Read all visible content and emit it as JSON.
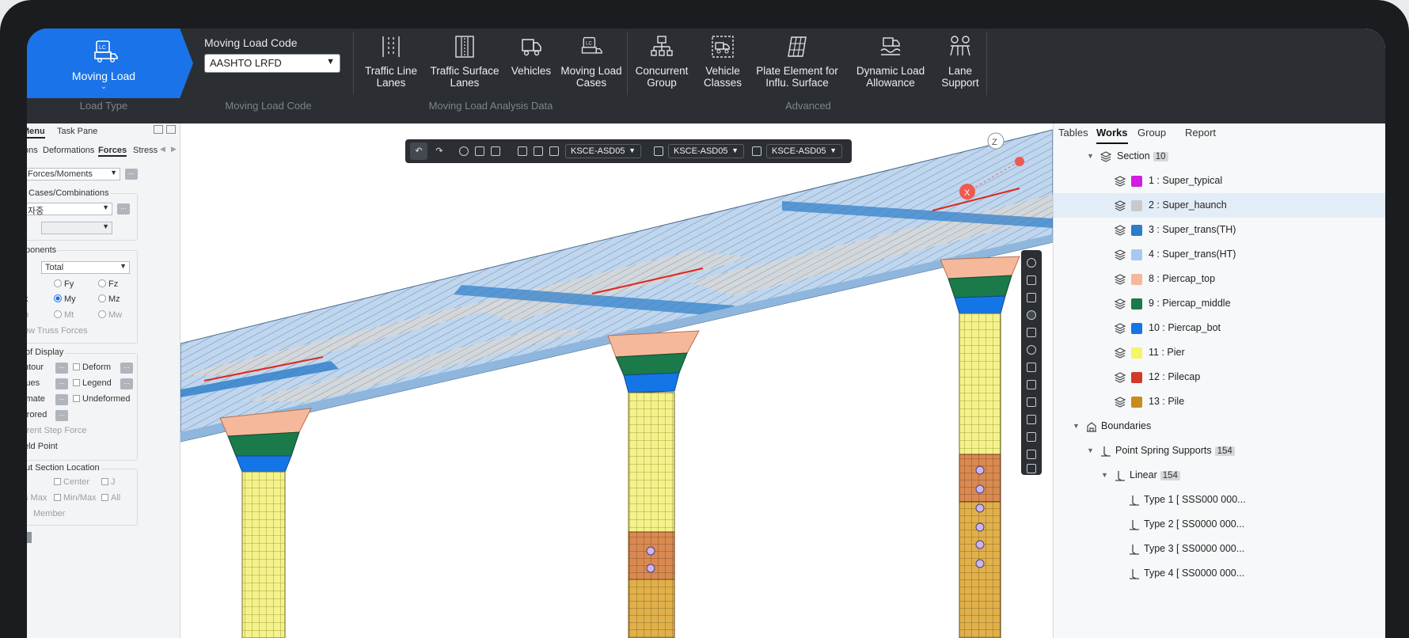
{
  "ribbon": {
    "active_tab": {
      "label": "Moving Load",
      "icon": "lc-truck-icon"
    },
    "moving_load_code": {
      "label": "Moving Load Code",
      "value": "AASHTO LRFD"
    },
    "buttons": [
      {
        "label": "Traffic Line Lanes",
        "icon": "traffic-line-icon"
      },
      {
        "label": "Traffic Surface Lanes",
        "icon": "traffic-surface-icon"
      },
      {
        "label": "Vehicles",
        "icon": "vehicle-icon"
      },
      {
        "label": "Moving Load Cases",
        "icon": "lc-truck-icon"
      },
      {
        "label": "Concurrent Group",
        "icon": "concurrent-group-icon"
      },
      {
        "label": "Vehicle Classes",
        "icon": "vehicle-classes-icon"
      },
      {
        "label": "Plate Element for Influ. Surface",
        "icon": "plate-element-icon"
      },
      {
        "label": "Dynamic Load Allowance",
        "icon": "dynamic-load-icon"
      },
      {
        "label": "Lane Support",
        "icon": "lane-support-icon"
      }
    ],
    "groups": [
      "Load Type",
      "Moving Load Code",
      "Moving Load Analysis Data",
      "Advanced"
    ]
  },
  "left_panel": {
    "tabs": [
      "Menu",
      "Task Pane"
    ],
    "result_tabs": [
      "ons",
      "Deformations",
      "Forces",
      "Stress"
    ],
    "active_result_tab": "Forces",
    "forces_select": "Forces/Moments",
    "load_cases_label": "Cases/Combinations",
    "load_case_value": "자중",
    "components_label": "ponents",
    "components_value": "Total",
    "radios": [
      "Fy",
      "Fz",
      "x",
      "My",
      "Mz",
      "p",
      "Mt",
      "Mw"
    ],
    "show_truss": "ow Truss Forces",
    "display_label": "of Display",
    "display_options": [
      "ntour",
      "Deform",
      "lues",
      "Legend",
      "imate",
      "Undeformed",
      "rrored"
    ],
    "current_step": "rrent Step Force",
    "yield_point": "eld Point",
    "section_location_label": "ut Section Location",
    "section_options": [
      "Center",
      "J",
      "s Max",
      "Min/Max",
      "All"
    ],
    "member": "Member"
  },
  "viewport": {
    "toolbar_selects": [
      "KSCE-ASD05",
      "KSCE-ASD05",
      "KSCE-ASD05"
    ],
    "axis_labels": {
      "z": "Z",
      "x": "X"
    }
  },
  "right_panel": {
    "tabs": [
      "Tables",
      "Works",
      "Group",
      "Report"
    ],
    "active_tab": "Works",
    "section": {
      "label": "Section",
      "count": "10"
    },
    "sections": [
      {
        "label": "1 : Super_typical",
        "color": "#d21ce0"
      },
      {
        "label": "2 : Super_haunch",
        "color": "#c9c9c9"
      },
      {
        "label": "3 : Super_trans(TH)",
        "color": "#2b7cc9"
      },
      {
        "label": "4 : Super_trans(HT)",
        "color": "#a8c8f0"
      },
      {
        "label": "8 : Piercap_top",
        "color": "#f6b89a"
      },
      {
        "label": "9 : Piercap_middle",
        "color": "#1a7a4a"
      },
      {
        "label": "10 : Piercap_bot",
        "color": "#1476e6"
      },
      {
        "label": "11 : Pier",
        "color": "#f5f56a"
      },
      {
        "label": "12 : Pilecap",
        "color": "#cf3b2a"
      },
      {
        "label": "13 : Pile",
        "color": "#c98a1e"
      }
    ],
    "boundaries": {
      "label": "Boundaries"
    },
    "point_spring": {
      "label": "Point Spring Supports",
      "count": "154"
    },
    "linear": {
      "label": "Linear",
      "count": "154"
    },
    "types": [
      "Type 1 [ SSS000 000...",
      "Type 2 [ SS0000 000...",
      "Type 3 [ SS0000 000...",
      "Type 4 [ SS0000 000..."
    ]
  }
}
